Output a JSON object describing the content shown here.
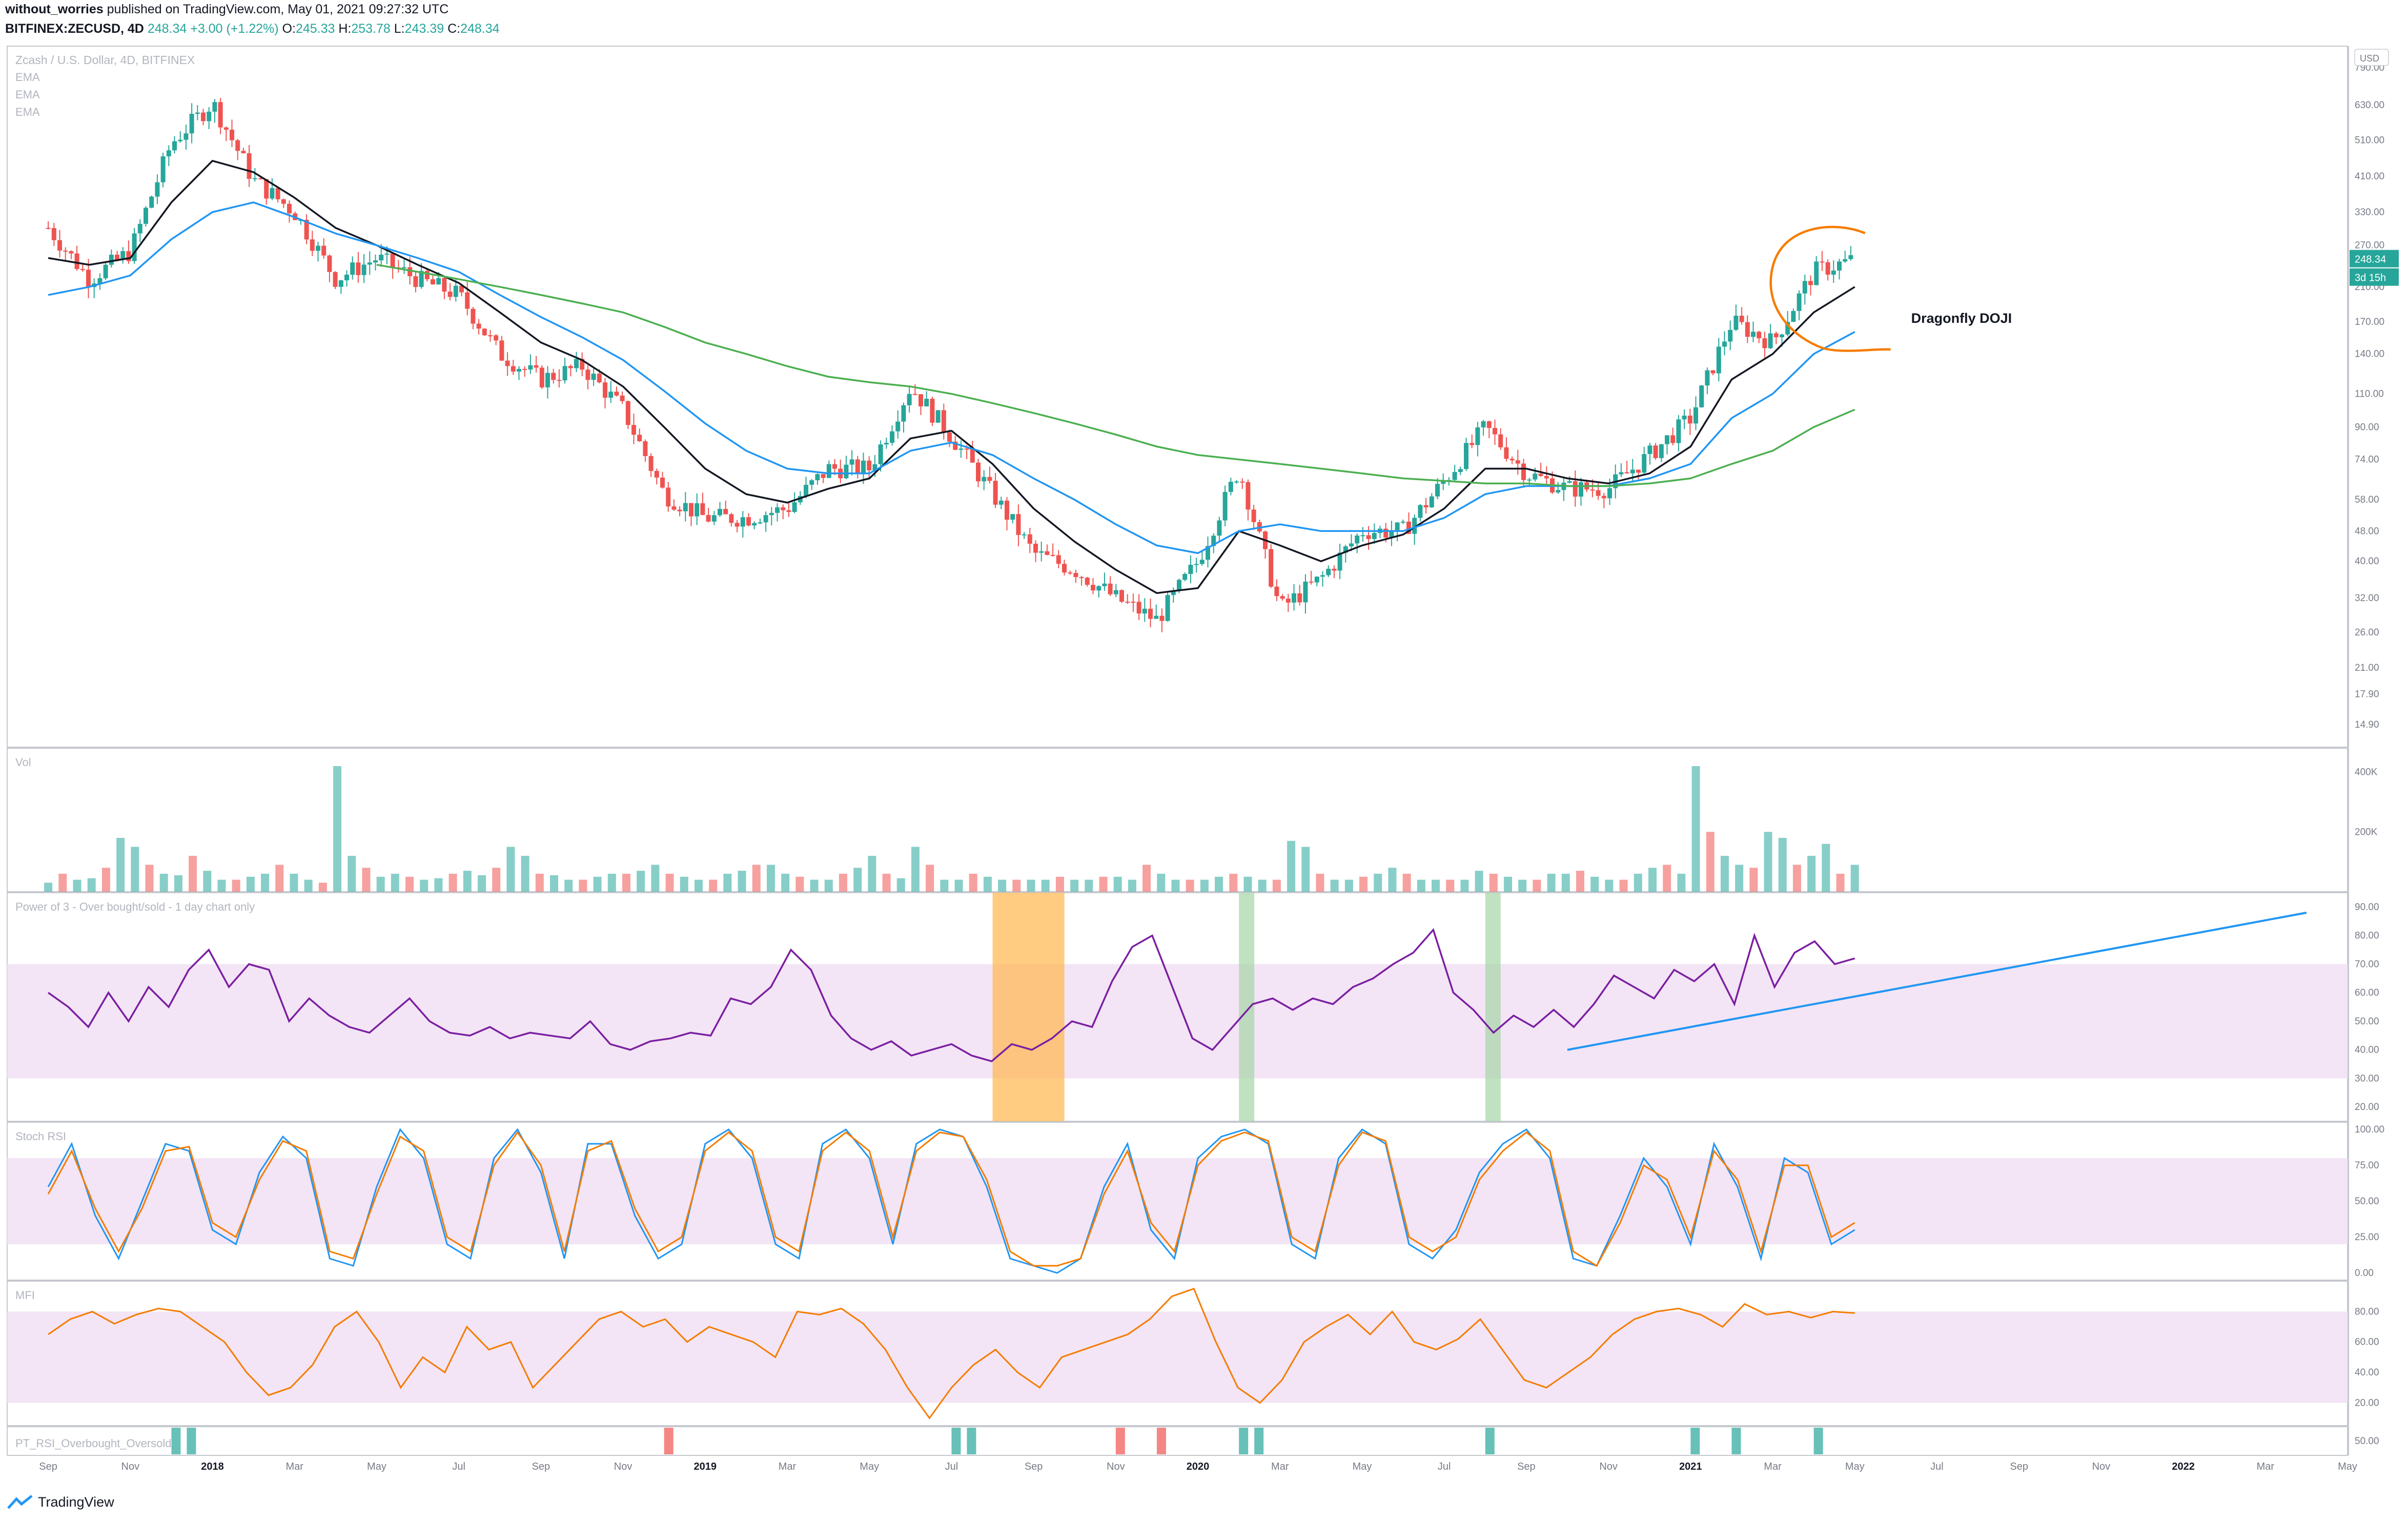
{
  "header": {
    "author": "without_worries",
    "published_text": "published on TradingView.com, May 01, 2021 09:27:32 UTC",
    "symbol": "BITFINEX:ZECUSD, 4D",
    "last": "248.34",
    "change": "+3.00 (+1.22%)",
    "o_label": "O:",
    "o": "245.33",
    "h_label": "H:",
    "h": "253.78",
    "l_label": "L:",
    "l": "243.39",
    "c_label": "C:",
    "c": "248.34"
  },
  "footer": {
    "brand": "TradingView"
  },
  "colors": {
    "up": "#26a69a",
    "down": "#ef5350",
    "up_candle": "#26a69a",
    "down_candle": "#ef5350",
    "ema_short": "#131722",
    "ema_mid": "#2196f3",
    "ema_long": "#4caf50",
    "purple": "#7b1fa2",
    "band": "#f3e5f5",
    "orange": "#f57c00",
    "blue": "#2196f3",
    "orange_block": "#ffb74d",
    "green_block": "#a5d6a7"
  },
  "chart_data": [
    {
      "type": "line",
      "title": "Zcash / U.S. Dollar, 4D, BITFINEX",
      "legend": [
        "EMA",
        "EMA",
        "EMA"
      ],
      "y_scale": "log",
      "y_ticks": [
        "790.00",
        "630.00",
        "510.00",
        "410.00",
        "330.00",
        "270.00",
        "210.00",
        "170.00",
        "140.00",
        "110.00",
        "90.00",
        "74.00",
        "58.00",
        "48.00",
        "40.00",
        "32.00",
        "26.00",
        "21.00",
        "17.90",
        "14.90"
      ],
      "x_ticks": [
        "Sep",
        "Nov",
        "2018",
        "Mar",
        "May",
        "Jul",
        "Sep",
        "Nov",
        "2019",
        "Mar",
        "May",
        "Jul",
        "Sep",
        "Nov",
        "2020",
        "Mar",
        "May",
        "Jul",
        "Sep",
        "Nov",
        "2021",
        "Mar",
        "May",
        "Jul",
        "Sep",
        "Nov",
        "2022",
        "Mar",
        "May"
      ],
      "x_range": [
        "2017-08",
        "2022-05"
      ],
      "last_price_label": "248.34",
      "countdown_label": "3d 15h",
      "currency_badge": "USD",
      "annotation": "Dragonfly DOJI",
      "close_series": {
        "x": [
          "2017-09",
          "2017-10",
          "2017-11",
          "2017-12",
          "2018-01",
          "2018-02",
          "2018-03",
          "2018-04",
          "2018-05",
          "2018-06",
          "2018-07",
          "2018-08",
          "2018-09",
          "2018-10",
          "2018-11",
          "2018-12",
          "2019-01",
          "2019-02",
          "2019-03",
          "2019-04",
          "2019-05",
          "2019-06",
          "2019-07",
          "2019-08",
          "2019-09",
          "2019-10",
          "2019-11",
          "2019-12",
          "2020-01",
          "2020-02",
          "2020-03",
          "2020-04",
          "2020-05",
          "2020-06",
          "2020-07",
          "2020-08",
          "2020-09",
          "2020-10",
          "2020-11",
          "2020-12",
          "2021-01",
          "2021-02",
          "2021-03",
          "2021-04",
          "2021-05"
        ],
        "y": [
          300,
          220,
          260,
          500,
          640,
          400,
          330,
          220,
          250,
          220,
          200,
          140,
          120,
          130,
          100,
          60,
          52,
          52,
          55,
          70,
          70,
          115,
          85,
          60,
          42,
          38,
          32,
          28,
          40,
          70,
          30,
          36,
          48,
          48,
          65,
          90,
          68,
          62,
          62,
          76,
          95,
          170,
          150,
          230,
          248
        ]
      },
      "ema_series": [
        {
          "name": "EMA",
          "y": [
            250,
            240,
            250,
            350,
            450,
            420,
            360,
            300,
            270,
            240,
            215,
            180,
            150,
            135,
            115,
            90,
            70,
            60,
            57,
            62,
            66,
            84,
            88,
            72,
            55,
            45,
            38,
            33,
            34,
            48,
            44,
            40,
            44,
            47,
            55,
            70,
            70,
            66,
            64,
            68,
            80,
            120,
            140,
            180,
            210
          ]
        },
        {
          "name": "EMA",
          "y": [
            200,
            210,
            225,
            280,
            330,
            350,
            320,
            290,
            270,
            250,
            230,
            200,
            175,
            155,
            135,
            112,
            92,
            78,
            70,
            68,
            68,
            78,
            82,
            76,
            66,
            58,
            50,
            44,
            42,
            48,
            50,
            48,
            48,
            48,
            52,
            60,
            63,
            63,
            63,
            66,
            72,
            95,
            110,
            140,
            160
          ]
        },
        {
          "name": "EMA",
          "y": [
            null,
            null,
            null,
            null,
            null,
            null,
            null,
            null,
            240,
            230,
            220,
            210,
            200,
            190,
            180,
            165,
            150,
            140,
            130,
            122,
            118,
            115,
            110,
            104,
            98,
            92,
            86,
            80,
            76,
            74,
            72,
            70,
            68,
            66,
            65,
            64,
            64,
            63,
            63,
            64,
            66,
            72,
            78,
            90,
            100
          ]
        }
      ]
    },
    {
      "type": "bar",
      "title": "Vol",
      "y_ticks": [
        "400K",
        "200K"
      ],
      "values": [
        30,
        60,
        40,
        45,
        80,
        180,
        150,
        90,
        60,
        55,
        120,
        70,
        40,
        40,
        50,
        60,
        90,
        60,
        40,
        30,
        420,
        120,
        80,
        50,
        60,
        50,
        40,
        45,
        60,
        70,
        55,
        80,
        150,
        120,
        60,
        55,
        40,
        40,
        50,
        60,
        60,
        70,
        90,
        60,
        50,
        40,
        40,
        60,
        70,
        90,
        90,
        60,
        50,
        40,
        40,
        60,
        80,
        120,
        60,
        45,
        150,
        90,
        40,
        40,
        60,
        50,
        40,
        40,
        40,
        40,
        50,
        40,
        40,
        50,
        50,
        40,
        90,
        60,
        40,
        40,
        40,
        50,
        60,
        50,
        40,
        40,
        170,
        150,
        60,
        40,
        40,
        50,
        60,
        80,
        60,
        40,
        40,
        40,
        40,
        70,
        60,
        50,
        40,
        40,
        60,
        60,
        70,
        50,
        40,
        40,
        60,
        80,
        90,
        60,
        420,
        200,
        120,
        90,
        80,
        200,
        180,
        90,
        120,
        160,
        60,
        90
      ]
    },
    {
      "type": "line",
      "title": "Power of 3 - Over bought/sold - 1 day chart only",
      "y_ticks": [
        "90.00",
        "80.00",
        "70.00",
        "60.00",
        "50.00",
        "40.00",
        "30.00",
        "20.00"
      ],
      "band": [
        30,
        70
      ],
      "series": [
        {
          "name": "",
          "y": [
            60,
            55,
            48,
            60,
            50,
            62,
            55,
            68,
            75,
            62,
            70,
            68,
            50,
            58,
            52,
            48,
            46,
            52,
            58,
            50,
            46,
            45,
            48,
            44,
            46,
            45,
            44,
            50,
            42,
            40,
            43,
            44,
            46,
            45,
            58,
            56,
            62,
            75,
            68,
            52,
            44,
            40,
            43,
            38,
            40,
            42,
            38,
            36,
            42,
            40,
            44,
            50,
            48,
            64,
            76,
            80,
            62,
            44,
            40,
            48,
            56,
            58,
            54,
            58,
            56,
            62,
            65,
            70,
            74,
            82,
            60,
            54,
            46,
            52,
            48,
            54,
            48,
            56,
            66,
            62,
            58,
            68,
            64,
            70,
            56,
            80,
            62,
            74,
            78,
            70,
            72
          ]
        }
      ],
      "trendline": {
        "from": [
          "2020-10",
          40
        ],
        "to": [
          "2022-04",
          88
        ]
      },
      "highlights": [
        {
          "label": "",
          "from": "2019-08",
          "to": "2019-09",
          "color": "orange"
        },
        {
          "label": "",
          "from": "2020-02",
          "to": "2020-02",
          "color": "green"
        },
        {
          "label": "",
          "from": "2020-08",
          "to": "2020-08",
          "color": "green"
        }
      ]
    },
    {
      "type": "line",
      "title": "Stoch RSI",
      "y_ticks": [
        "100.00",
        "75.00",
        "50.00",
        "25.00",
        "0.00"
      ],
      "band": [
        20,
        80
      ],
      "series": [
        {
          "name": "",
          "y": [
            60,
            90,
            40,
            10,
            50,
            90,
            85,
            30,
            20,
            70,
            95,
            80,
            10,
            5,
            60,
            100,
            80,
            20,
            10,
            80,
            100,
            70,
            10,
            90,
            90,
            40,
            10,
            20,
            90,
            100,
            80,
            20,
            10,
            90,
            100,
            80,
            20,
            90,
            100,
            95,
            60,
            10,
            5,
            0,
            10,
            60,
            90,
            30,
            10,
            80,
            95,
            100,
            90,
            20,
            10,
            80,
            100,
            90,
            20,
            10,
            30,
            70,
            90,
            100,
            80,
            10,
            5,
            40,
            80,
            60,
            20,
            90,
            60,
            10,
            80,
            70,
            20,
            30
          ]
        },
        {
          "name": "",
          "y": [
            55,
            85,
            45,
            15,
            45,
            85,
            88,
            35,
            25,
            65,
            92,
            85,
            15,
            10,
            55,
            95,
            85,
            25,
            15,
            75,
            98,
            75,
            15,
            85,
            92,
            45,
            15,
            25,
            85,
            98,
            85,
            25,
            15,
            85,
            98,
            85,
            25,
            85,
            98,
            95,
            65,
            15,
            5,
            5,
            10,
            55,
            85,
            35,
            15,
            75,
            92,
            98,
            92,
            25,
            15,
            75,
            98,
            92,
            25,
            15,
            25,
            65,
            85,
            98,
            85,
            15,
            5,
            35,
            75,
            65,
            25,
            85,
            65,
            15,
            75,
            75,
            25,
            35
          ]
        }
      ]
    },
    {
      "type": "line",
      "title": "MFI",
      "y_ticks": [
        "80.00",
        "60.00",
        "40.00",
        "20.00"
      ],
      "band": [
        20,
        80
      ],
      "series": [
        {
          "name": "",
          "y": [
            65,
            75,
            80,
            72,
            78,
            82,
            80,
            70,
            60,
            40,
            25,
            30,
            45,
            70,
            80,
            60,
            30,
            50,
            40,
            70,
            55,
            60,
            30,
            45,
            60,
            75,
            80,
            70,
            75,
            60,
            70,
            65,
            60,
            50,
            80,
            78,
            82,
            72,
            55,
            30,
            10,
            30,
            45,
            55,
            40,
            30,
            50,
            55,
            60,
            65,
            75,
            90,
            95,
            60,
            30,
            20,
            35,
            60,
            70,
            78,
            65,
            80,
            60,
            55,
            62,
            75,
            55,
            35,
            30,
            40,
            50,
            65,
            75,
            80,
            82,
            78,
            70,
            85,
            78,
            80,
            76,
            80,
            79
          ]
        }
      ]
    },
    {
      "type": "bar",
      "title": "PT_RSI_Overbought_Oversold",
      "y_ticks": [
        "50.00"
      ],
      "signals": [
        {
          "label": "",
          "x": "2017-12",
          "color": "green"
        },
        {
          "label": "",
          "x": "2017-12",
          "color": "green"
        },
        {
          "label": "",
          "x": "2018-12",
          "color": "red"
        },
        {
          "label": "",
          "x": "2019-07",
          "color": "green"
        },
        {
          "label": "",
          "x": "2019-07",
          "color": "green"
        },
        {
          "label": "",
          "x": "2019-11",
          "color": "red"
        },
        {
          "label": "",
          "x": "2019-12",
          "color": "red"
        },
        {
          "label": "",
          "x": "2020-02",
          "color": "green"
        },
        {
          "label": "",
          "x": "2020-02",
          "color": "green"
        },
        {
          "label": "",
          "x": "2020-08",
          "color": "green"
        },
        {
          "label": "",
          "x": "2021-01",
          "color": "green"
        },
        {
          "label": "",
          "x": "2021-02",
          "color": "green"
        },
        {
          "label": "",
          "x": "2021-04",
          "color": "green"
        }
      ]
    }
  ]
}
